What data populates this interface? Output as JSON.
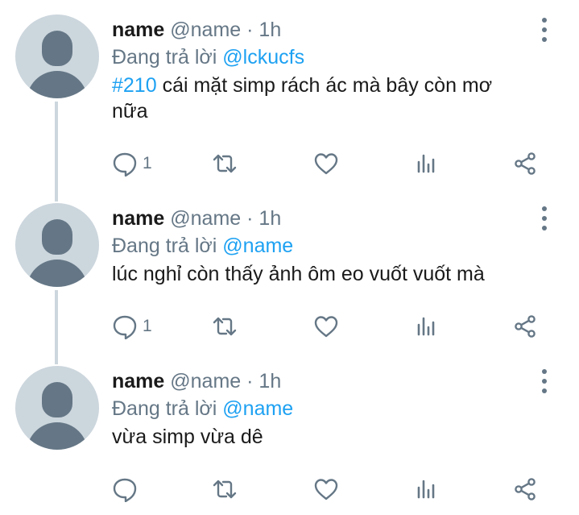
{
  "tweets": [
    {
      "name": "name",
      "handle": "@name",
      "separator": "·",
      "time": "1h",
      "reply_prefix": "Đang trả lời",
      "reply_to": "@lckucfs",
      "hashtag": "#210",
      "text": " cái mặt simp rách ác mà bây còn mơ nữa",
      "reply_count": "1",
      "actions": [
        "reply-icon",
        "retweet-icon",
        "like-icon",
        "analytics-icon",
        "share-icon"
      ]
    },
    {
      "name": "name",
      "handle": "@name",
      "separator": "·",
      "time": "1h",
      "reply_prefix": "Đang trả lời",
      "reply_to": "@name",
      "text": "lúc nghỉ còn thấy ảnh ôm eo vuốt vuốt mà",
      "reply_count": "1",
      "actions": [
        "reply-icon",
        "retweet-icon",
        "like-icon",
        "analytics-icon",
        "share-icon"
      ]
    },
    {
      "name": "name",
      "handle": "@name",
      "separator": "·",
      "time": "1h",
      "reply_prefix": "Đang trả lời",
      "reply_to": "@name",
      "text": "vừa simp vừa dê",
      "reply_count": "",
      "actions": [
        "reply-icon",
        "retweet-icon",
        "like-icon",
        "analytics-icon",
        "share-icon"
      ]
    }
  ],
  "colors": {
    "accent": "#1da1f2",
    "muted": "#657786",
    "avatar_bg": "#ccd6dd"
  }
}
